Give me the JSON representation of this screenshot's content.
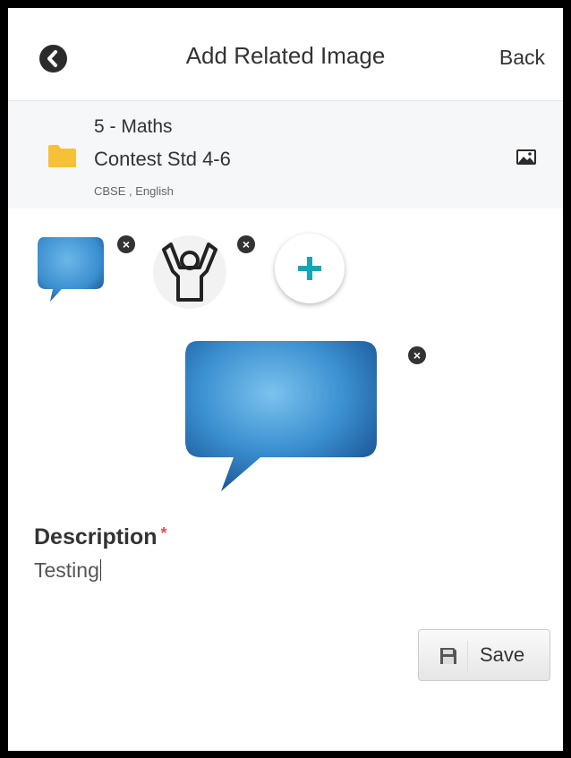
{
  "header": {
    "title": "Add Related Image",
    "back_label": "Back"
  },
  "folder": {
    "line1": "5 - Maths",
    "line2": "Contest Std 4-6",
    "meta": "CBSE , English",
    "icon": "folder-icon",
    "accent": "#f7c137"
  },
  "thumbnails": [
    {
      "name": "speech-bubble",
      "close_icon": "close-icon"
    },
    {
      "name": "raised-arms-person",
      "close_icon": "close-icon"
    }
  ],
  "add_button": {
    "icon": "plus-icon",
    "color": "#1aa3b5"
  },
  "preview": {
    "name": "speech-bubble",
    "close_icon": "close-icon",
    "color": "#3a8fd0"
  },
  "description": {
    "label": "Description",
    "required_mark": "*",
    "value": "Testing"
  },
  "save_button": {
    "label": "Save",
    "icon": "save-icon"
  }
}
